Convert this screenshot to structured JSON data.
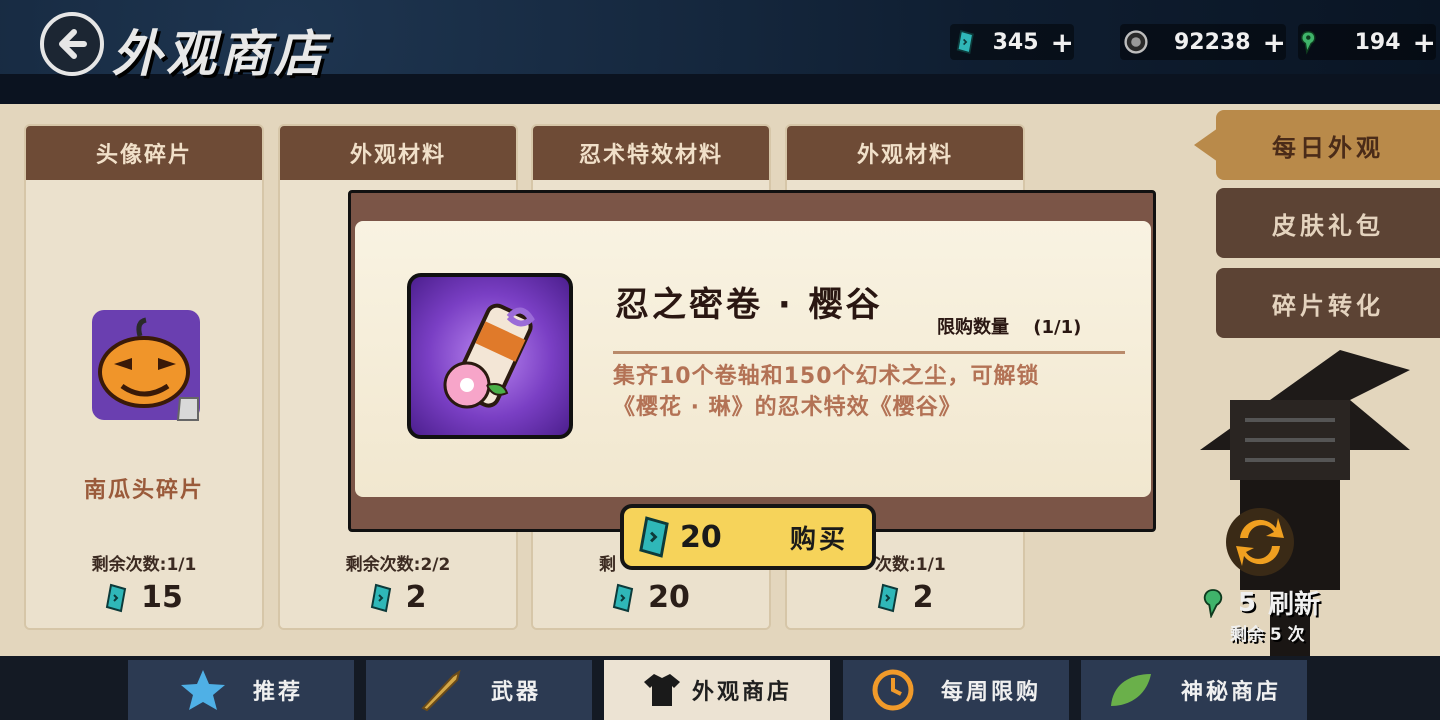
{
  "header": {
    "title": "外观商店",
    "currencies": [
      {
        "icon": "ticket-icon",
        "value": "345"
      },
      {
        "icon": "coin-icon",
        "value": "92238"
      },
      {
        "icon": "jade-icon",
        "value": "194"
      }
    ],
    "plus_label": "+"
  },
  "cards": [
    {
      "category": "头像碎片",
      "name": "南瓜头碎片",
      "remain": "剩余次数:1/1",
      "price": "15"
    },
    {
      "category": "外观材料",
      "name": "",
      "remain": "剩余次数:2/2",
      "price": "2"
    },
    {
      "category": "忍术特效材料",
      "name": "",
      "remain": "剩",
      "price": "20"
    },
    {
      "category": "外观材料",
      "name": "",
      "remain": "次数:1/1",
      "price": "2"
    }
  ],
  "side_tabs": [
    {
      "label": "每日外观",
      "active": true
    },
    {
      "label": "皮肤礼包",
      "active": false
    },
    {
      "label": "碎片转化",
      "active": false
    }
  ],
  "modal": {
    "title": "忍之密卷 · 樱谷",
    "limit_label": "限购数量",
    "limit_value": "(1/1)",
    "description": "集齐10个卷轴和150个幻术之尘，可解锁《樱花 · 琳》的忍术特效《樱谷》",
    "price": "20",
    "buy_label": "购买"
  },
  "refresh": {
    "count": "5",
    "label": "刷新",
    "remain": "剩余 5 次"
  },
  "bottom_tabs": [
    {
      "label": "推荐",
      "icon": "star-icon",
      "active": false
    },
    {
      "label": "武器",
      "icon": "weapon-icon",
      "active": false
    },
    {
      "label": "外观商店",
      "icon": "shirt-icon",
      "active": true
    },
    {
      "label": "每周限购",
      "icon": "clock-icon",
      "active": false
    },
    {
      "label": "神秘商店",
      "icon": "leaf-icon",
      "active": false
    }
  ],
  "colors": {
    "accent": "#f6d35a",
    "card_header": "#6e4b36",
    "ticket": "#2fb7b8"
  }
}
